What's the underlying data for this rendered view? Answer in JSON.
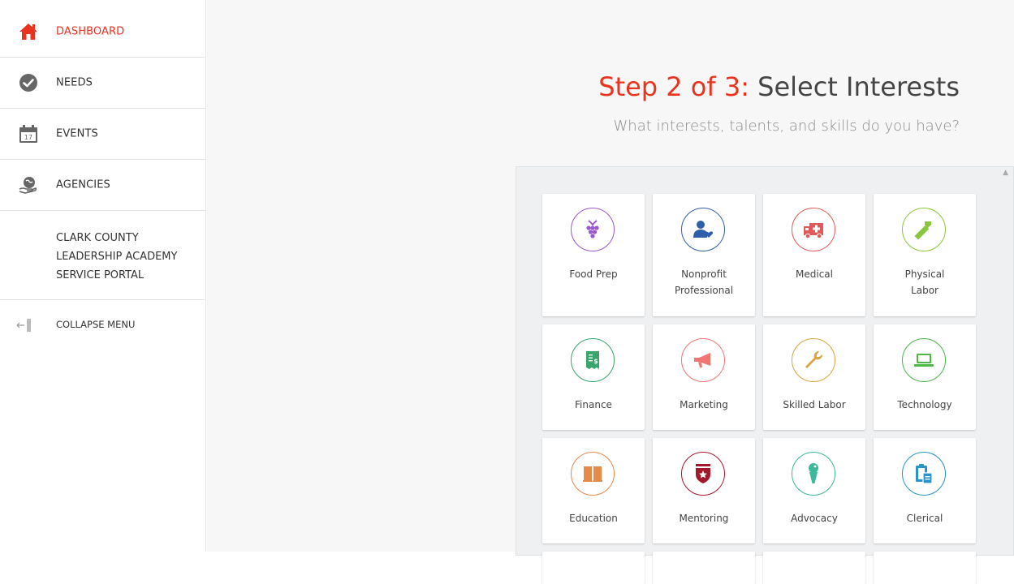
{
  "sidebar": {
    "items": [
      {
        "label": "DASHBOARD",
        "icon": "home-icon"
      },
      {
        "label": "NEEDS",
        "icon": "checkmark-icon"
      },
      {
        "label": "EVENTS",
        "icon": "calendar-icon",
        "calendar_day": "17"
      },
      {
        "label": "AGENCIES",
        "icon": "globe-hand-icon"
      }
    ],
    "portal_title": [
      "CLARK COUNTY",
      "LEADERSHIP ACADEMY",
      "SERVICE PORTAL"
    ],
    "collapse_label": "COLLAPSE MENU"
  },
  "heading": {
    "step": "Step 2 of 3:",
    "title": "Select Interests",
    "subtitle": "What interests, talents, and skills do you have?"
  },
  "interests": [
    {
      "label": "Food Prep",
      "icon": "grapes-icon",
      "color": "#9b59d0"
    },
    {
      "label": "Nonprofit Professional",
      "icon": "person-heart-icon",
      "color": "#2e5fa8"
    },
    {
      "label": "Medical",
      "icon": "ambulance-icon",
      "color": "#e05a5a"
    },
    {
      "label": "Physical Labor",
      "icon": "hammer-icon",
      "color": "#8cc63e"
    },
    {
      "label": "Finance",
      "icon": "receipt-icon",
      "color": "#3aa56a"
    },
    {
      "label": "Marketing",
      "icon": "megaphone-icon",
      "color": "#f07575"
    },
    {
      "label": "Skilled Labor",
      "icon": "wrench-icon",
      "color": "#d9a441"
    },
    {
      "label": "Technology",
      "icon": "laptop-icon",
      "color": "#4cb848"
    },
    {
      "label": "Education",
      "icon": "book-icon",
      "color": "#e68a4a"
    },
    {
      "label": "Mentoring",
      "icon": "shield-star-icon",
      "color": "#a3172a"
    },
    {
      "label": "Advocacy",
      "icon": "microphone-icon",
      "color": "#3cb89a"
    },
    {
      "label": "Clerical",
      "icon": "clipboard-icon",
      "color": "#2a93c9"
    }
  ],
  "colors": {
    "accent": "#e8331f"
  }
}
